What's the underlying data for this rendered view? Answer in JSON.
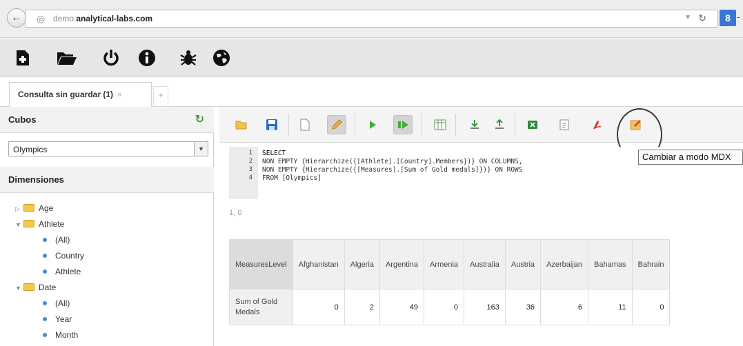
{
  "browser": {
    "url_prefix": "demo.",
    "url_domain": "analytical-labs.com",
    "google_label": "8",
    "google_dash": "-"
  },
  "app_toolbar": {
    "icons": [
      "new-query-icon",
      "open-folder-icon",
      "power-icon",
      "info-icon",
      "bug-icon",
      "globe-icon"
    ]
  },
  "tabs": [
    {
      "label": "Consulta sin guardar (1)",
      "close": "×"
    }
  ],
  "tab_add": "+",
  "sidebar": {
    "cubes_title": "Cubos",
    "selected_cube": "Olympics",
    "dimensions_title": "Dimensiones",
    "tree": [
      {
        "label": "Age",
        "type": "folder",
        "expanded": false
      },
      {
        "label": "Athlete",
        "type": "folder",
        "expanded": true
      },
      {
        "label": "(All)",
        "type": "level"
      },
      {
        "label": "Country",
        "type": "level"
      },
      {
        "label": "Athlete",
        "type": "level"
      },
      {
        "label": "Date",
        "type": "folder",
        "expanded": true
      },
      {
        "label": "(All)",
        "type": "level"
      },
      {
        "label": "Year",
        "type": "level"
      },
      {
        "label": "Month",
        "type": "level"
      }
    ]
  },
  "query_toolbar": {
    "tooltip": "Cambiar a modo MDX"
  },
  "editor": {
    "line_numbers": [
      "1",
      "2",
      "3",
      "4"
    ],
    "lines": [
      "SELECT",
      "NON EMPTY {Hierarchize({[Athlete].[Country].Members})} ON COLUMNS,",
      "NON EMPTY {Hierarchize({[Measures].[Sum of Gold medals]})} ON ROWS",
      "FROM [Olympics]"
    ]
  },
  "status": "1, 0",
  "result": {
    "corner": "MeasuresLevel",
    "columns": [
      "Afghanistan",
      "Algeria",
      "Argentina",
      "Armenia",
      "Australia",
      "Austria",
      "Azerbaijan",
      "Bahamas",
      "Bahrain"
    ],
    "rows": [
      {
        "label": "Sum of Gold Medals",
        "values": [
          "0",
          "2",
          "49",
          "0",
          "163",
          "36",
          "6",
          "11",
          "0"
        ]
      }
    ]
  }
}
